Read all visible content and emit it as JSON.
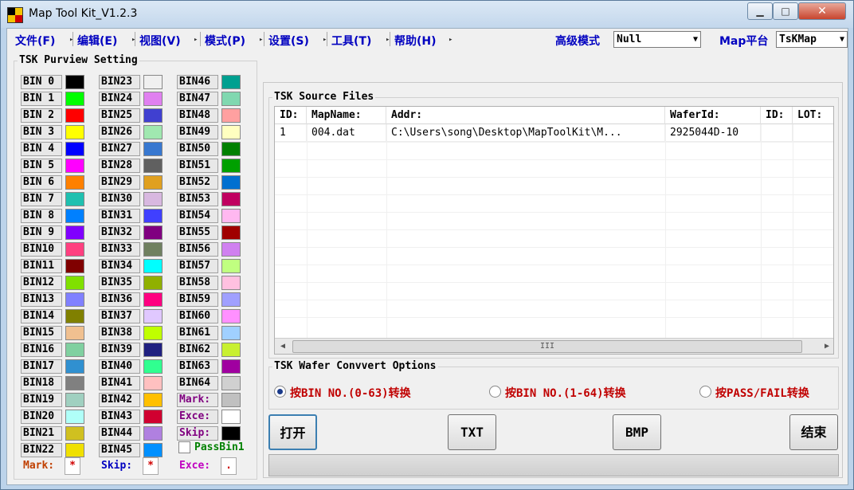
{
  "window": {
    "title": "Map Tool Kit_V1.2.3",
    "close_glyph": "✕",
    "min_glyph": "▁",
    "max_glyph": "□"
  },
  "menu": {
    "items": [
      "文件(F)",
      "编辑(E)",
      "视图(V)",
      "模式(P)",
      "设置(S)",
      "工具(T)",
      "帮助(H)"
    ],
    "arrow": "▸",
    "advanced_mode_label": "高级模式",
    "advanced_mode_value": "Null",
    "map_platform_label": "Map平台",
    "map_platform_value": "TsKMap",
    "dropdown_arrow": "▼"
  },
  "purview": {
    "title": "TSK Purview Setting",
    "bins": [
      {
        "label": "BIN 0",
        "color": "#000000"
      },
      {
        "label": "BIN 1",
        "color": "#00ff00"
      },
      {
        "label": "BIN 2",
        "color": "#ff0000"
      },
      {
        "label": "BIN 3",
        "color": "#ffff00"
      },
      {
        "label": "BIN 4",
        "color": "#0000ff"
      },
      {
        "label": "BIN 5",
        "color": "#ff00ff"
      },
      {
        "label": "BIN 6",
        "color": "#ff8000"
      },
      {
        "label": "BIN 7",
        "color": "#20c0b0"
      },
      {
        "label": "BIN 8",
        "color": "#0080ff"
      },
      {
        "label": "BIN 9",
        "color": "#8000ff"
      },
      {
        "label": "BIN10",
        "color": "#ff4080"
      },
      {
        "label": "BIN11",
        "color": "#800000"
      },
      {
        "label": "BIN12",
        "color": "#80e000"
      },
      {
        "label": "BIN13",
        "color": "#8080ff"
      },
      {
        "label": "BIN14",
        "color": "#808000"
      },
      {
        "label": "BIN15",
        "color": "#f0c090"
      },
      {
        "label": "BIN16",
        "color": "#80d0a0"
      },
      {
        "label": "BIN17",
        "color": "#3090d0"
      },
      {
        "label": "BIN18",
        "color": "#808080"
      },
      {
        "label": "BIN19",
        "color": "#a0d0c0"
      },
      {
        "label": "BIN20",
        "color": "#b0fff8"
      },
      {
        "label": "BIN21",
        "color": "#d0c020"
      },
      {
        "label": "BIN22",
        "color": "#f0e000"
      },
      {
        "label": "BIN23",
        "color": "#f0f0f0"
      },
      {
        "label": "BIN24",
        "color": "#e080f0"
      },
      {
        "label": "BIN25",
        "color": "#4040d0"
      },
      {
        "label": "BIN26",
        "color": "#a0e8b0"
      },
      {
        "label": "BIN27",
        "color": "#3878d0"
      },
      {
        "label": "BIN28",
        "color": "#606060"
      },
      {
        "label": "BIN29",
        "color": "#e0a020"
      },
      {
        "label": "BIN30",
        "color": "#d8b8e0"
      },
      {
        "label": "BIN31",
        "color": "#4040ff"
      },
      {
        "label": "BIN32",
        "color": "#800080"
      },
      {
        "label": "BIN33",
        "color": "#708060"
      },
      {
        "label": "BIN34",
        "color": "#00ffff"
      },
      {
        "label": "BIN35",
        "color": "#90b000"
      },
      {
        "label": "BIN36",
        "color": "#ff0080"
      },
      {
        "label": "BIN37",
        "color": "#e0c8ff"
      },
      {
        "label": "BIN38",
        "color": "#c0ff00"
      },
      {
        "label": "BIN39",
        "color": "#202080"
      },
      {
        "label": "BIN40",
        "color": "#30ff90"
      },
      {
        "label": "BIN41",
        "color": "#ffc0c0"
      },
      {
        "label": "BIN42",
        "color": "#ffc000"
      },
      {
        "label": "BIN43",
        "color": "#d00030"
      },
      {
        "label": "BIN44",
        "color": "#b080e0"
      },
      {
        "label": "BIN45",
        "color": "#0090ff"
      },
      {
        "label": "BIN46",
        "color": "#00a090"
      },
      {
        "label": "BIN47",
        "color": "#80d8b0"
      },
      {
        "label": "BIN48",
        "color": "#ffa0a0"
      },
      {
        "label": "BIN49",
        "color": "#ffffc0"
      },
      {
        "label": "BIN50",
        "color": "#008000"
      },
      {
        "label": "BIN51",
        "color": "#00a000"
      },
      {
        "label": "BIN52",
        "color": "#0070d0"
      },
      {
        "label": "BIN53",
        "color": "#c00060"
      },
      {
        "label": "BIN54",
        "color": "#ffb8f0"
      },
      {
        "label": "BIN55",
        "color": "#a00000"
      },
      {
        "label": "BIN56",
        "color": "#d080f0"
      },
      {
        "label": "BIN57",
        "color": "#c0ff80"
      },
      {
        "label": "BIN58",
        "color": "#ffc0e0"
      },
      {
        "label": "BIN59",
        "color": "#a0a0ff"
      },
      {
        "label": "BIN60",
        "color": "#ff90ff"
      },
      {
        "label": "BIN61",
        "color": "#a0d0ff"
      },
      {
        "label": "BIN62",
        "color": "#c8f030"
      },
      {
        "label": "BIN63",
        "color": "#a000a0"
      },
      {
        "label": "BIN64",
        "color": "#d0d0d0"
      }
    ],
    "specials": [
      {
        "label": "Mark:",
        "color": "#c0c0c0"
      },
      {
        "label": "Exce:",
        "color": "#ffffff"
      },
      {
        "label": "Skip:",
        "color": "#000000"
      }
    ],
    "pass_bin_label": "PassBin1",
    "legend": [
      {
        "label": "Mark:",
        "value": "*",
        "color": "#c04000"
      },
      {
        "label": "Skip:",
        "value": "*",
        "color": "#0000c0"
      },
      {
        "label": "Exce:",
        "value": ".",
        "color": "#c000c0"
      }
    ]
  },
  "source_files": {
    "title": "TSK Source Files",
    "columns": [
      "ID:",
      "MapName:",
      "Addr:",
      "WaferId:",
      "ID:",
      "LOT:"
    ],
    "rows": [
      [
        "1",
        "004.dat",
        "C:\\Users\\song\\Desktop\\MapToolKit\\M...",
        "2925044D-10",
        "",
        ""
      ]
    ],
    "scroll_thumb": "III"
  },
  "convert": {
    "title": "TSK Wafer Convvert Options",
    "options": [
      "按BIN NO.(0-63)转换",
      "按BIN NO.(1-64)转换",
      "按PASS/FAIL转换"
    ],
    "selected_index": 0
  },
  "buttons": {
    "open": "打开",
    "txt": "TXT",
    "bmp": "BMP",
    "end": "结束"
  }
}
